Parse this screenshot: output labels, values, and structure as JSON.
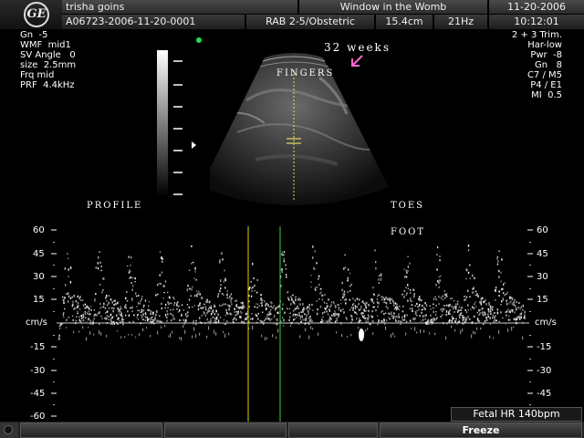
{
  "header": {
    "logo_text": "GE",
    "patient_name": "trisha goins",
    "exam_id": "A06723-2006-11-20-0001",
    "institution": "Window in the Womb",
    "probe_preset": "RAB 2-5/Obstetric",
    "depth": "15.4cm",
    "frame_rate": "21Hz",
    "date": "11-20-2006",
    "time": "10:12:01"
  },
  "params_left": [
    "Gn  -5",
    "WMF  mid1",
    "SV Angle   0",
    "size  2.5mm",
    "Frq mid",
    "PRF  4.4kHz"
  ],
  "params_right": [
    "2 + 3 Trim.",
    "Har-low",
    "Pwr  -8",
    "Gn   8",
    "C7 / M5",
    "P4 / E1",
    "MI  0.5"
  ],
  "annotations": {
    "weeks": "32 weeks",
    "fingers": "FINGERS",
    "profile": "PROFILE",
    "toes": "TOES",
    "foot": "FOOT"
  },
  "doppler": {
    "units": "cm/s",
    "scale_labels": [
      "60",
      "45",
      "30",
      "15",
      "-15",
      "-30",
      "-45",
      "-60"
    ],
    "fetal_hr": "Fetal HR 140bpm"
  },
  "footer": {
    "freeze_label": "Freeze"
  },
  "colors": {
    "caliper_yellow": "#d8d800",
    "caliper_green": "#40d040",
    "annotation_pink": "#ff66cc",
    "indicator_green": "#22dd55"
  }
}
